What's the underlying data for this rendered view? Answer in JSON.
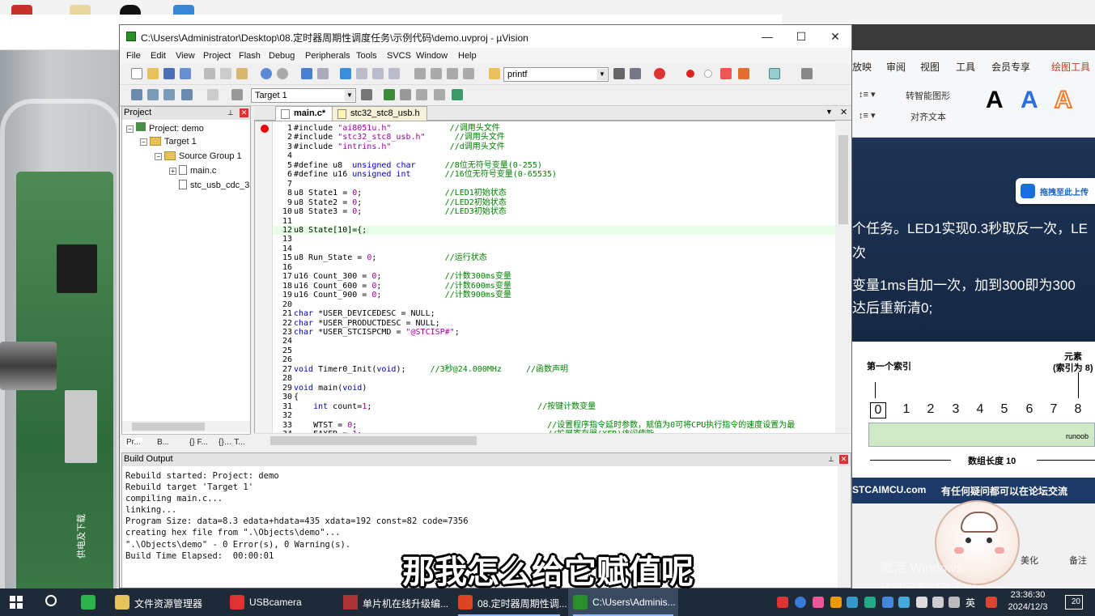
{
  "window": {
    "title": "C:\\Users\\Administrator\\Desktop\\08.定时器周期性调度任务\\示例代码\\demo.uvproj - µVision",
    "minimize": "—",
    "maximize": "☐",
    "close": "✕"
  },
  "menu": [
    "File",
    "Edit",
    "View",
    "Project",
    "Flash",
    "Debug",
    "Peripherals",
    "Tools",
    "SVCS",
    "Window",
    "Help"
  ],
  "toolbar": {
    "find_combo": "printf",
    "target_combo": "Target 1"
  },
  "project_panel": {
    "title": "Project",
    "root": "Project: demo",
    "target": "Target 1",
    "group": "Source Group 1",
    "files": [
      "main.c",
      "stc_usb_cdc_3"
    ],
    "tabs": [
      "Pr...",
      "B...",
      "{} F...",
      "{}… T..."
    ]
  },
  "editor": {
    "tabs": [
      "main.c*",
      "stc32_stc8_usb.h"
    ],
    "lines": [
      {
        "n": "1",
        "parts": [
          [
            "t",
            "#include "
          ],
          [
            "s",
            "\"ai8051u.h\""
          ],
          [
            "p",
            "            "
          ],
          [
            "c",
            "//调用头文件"
          ]
        ]
      },
      {
        "n": "2",
        "parts": [
          [
            "t",
            "#include "
          ],
          [
            "s",
            "\"stc32_stc8_usb.h\""
          ],
          [
            "p",
            "      "
          ],
          [
            "c",
            "//调用头文件"
          ]
        ]
      },
      {
        "n": "3",
        "parts": [
          [
            "t",
            "#include "
          ],
          [
            "s",
            "\"intrins.h\""
          ],
          [
            "p",
            "            "
          ],
          [
            "c",
            "//d调用头文件"
          ]
        ]
      },
      {
        "n": "4",
        "parts": []
      },
      {
        "n": "5",
        "parts": [
          [
            "t",
            "#define u8  "
          ],
          [
            "k",
            "unsigned char"
          ],
          [
            "p",
            "      "
          ],
          [
            "c",
            "//8位无符号变量(0-255)"
          ]
        ]
      },
      {
        "n": "6",
        "parts": [
          [
            "t",
            "#define u16 "
          ],
          [
            "k",
            "unsigned int"
          ],
          [
            "p",
            "       "
          ],
          [
            "c",
            "//16位无符号变量(0-65535)"
          ]
        ]
      },
      {
        "n": "7",
        "parts": []
      },
      {
        "n": "8",
        "parts": [
          [
            "t",
            "u8 State1 = "
          ],
          [
            "n",
            "0"
          ],
          [
            "t",
            ";"
          ],
          [
            "p",
            "                 "
          ],
          [
            "c",
            "//LED1初始状态"
          ]
        ]
      },
      {
        "n": "9",
        "parts": [
          [
            "t",
            "u8 State2 = "
          ],
          [
            "n",
            "0"
          ],
          [
            "t",
            ";"
          ],
          [
            "p",
            "                 "
          ],
          [
            "c",
            "//LED2初始状态"
          ]
        ]
      },
      {
        "n": "10",
        "parts": [
          [
            "t",
            "u8 State3 = "
          ],
          [
            "n",
            "0"
          ],
          [
            "t",
            ";"
          ],
          [
            "p",
            "                 "
          ],
          [
            "c",
            "//LED3初始状态"
          ]
        ]
      },
      {
        "n": "11",
        "parts": []
      },
      {
        "n": "12",
        "hl": true,
        "parts": [
          [
            "t",
            "u8 State[10]={;"
          ]
        ]
      },
      {
        "n": "13",
        "parts": []
      },
      {
        "n": "14",
        "parts": []
      },
      {
        "n": "15",
        "parts": [
          [
            "t",
            "u8 Run_State = "
          ],
          [
            "n",
            "0"
          ],
          [
            "t",
            ";"
          ],
          [
            "p",
            "              "
          ],
          [
            "c",
            "//运行状态"
          ]
        ]
      },
      {
        "n": "16",
        "parts": []
      },
      {
        "n": "17",
        "parts": [
          [
            "t",
            "u16 Count_300 = "
          ],
          [
            "n",
            "0"
          ],
          [
            "t",
            ";"
          ],
          [
            "p",
            "             "
          ],
          [
            "c",
            "//计数300ms变量"
          ]
        ]
      },
      {
        "n": "18",
        "parts": [
          [
            "t",
            "u16 Count_600 = "
          ],
          [
            "n",
            "0"
          ],
          [
            "t",
            ";"
          ],
          [
            "p",
            "             "
          ],
          [
            "c",
            "//计数600ms变量"
          ]
        ]
      },
      {
        "n": "19",
        "parts": [
          [
            "t",
            "u16 Count_900 = "
          ],
          [
            "n",
            "0"
          ],
          [
            "t",
            ";"
          ],
          [
            "p",
            "             "
          ],
          [
            "c",
            "//计数900ms变量"
          ]
        ]
      },
      {
        "n": "20",
        "parts": []
      },
      {
        "n": "21",
        "parts": [
          [
            "k",
            "char"
          ],
          [
            "t",
            " *USER_DEVICEDESC = NULL;"
          ]
        ]
      },
      {
        "n": "22",
        "parts": [
          [
            "k",
            "char"
          ],
          [
            "t",
            " *USER_PRODUCTDESC = NULL;"
          ]
        ]
      },
      {
        "n": "23",
        "parts": [
          [
            "k",
            "char"
          ],
          [
            "t",
            " *USER_STCISPCMD = "
          ],
          [
            "s",
            "\"@STCISP#\""
          ],
          [
            "t",
            ";"
          ]
        ]
      },
      {
        "n": "24",
        "parts": []
      },
      {
        "n": "25",
        "parts": []
      },
      {
        "n": "26",
        "parts": []
      },
      {
        "n": "27",
        "parts": [
          [
            "k",
            "void"
          ],
          [
            "t",
            " Timer0_Init("
          ],
          [
            "k",
            "void"
          ],
          [
            "t",
            ");"
          ],
          [
            "p",
            "     "
          ],
          [
            "c",
            "//3秒@24.000MHz"
          ],
          [
            "p",
            "     "
          ],
          [
            "c",
            "//函数声明"
          ]
        ]
      },
      {
        "n": "28",
        "parts": []
      },
      {
        "n": "29",
        "parts": [
          [
            "k",
            "void"
          ],
          [
            "t",
            " main("
          ],
          [
            "k",
            "void"
          ],
          [
            "t",
            ")"
          ]
        ]
      },
      {
        "n": "30",
        "parts": [
          [
            "t",
            "{"
          ]
        ]
      },
      {
        "n": "31",
        "parts": [
          [
            "p",
            "    "
          ],
          [
            "k",
            "int"
          ],
          [
            "t",
            " count="
          ],
          [
            "n",
            "1"
          ],
          [
            "t",
            ";"
          ],
          [
            "p",
            "                                  "
          ],
          [
            "c",
            "//按键计数变量"
          ]
        ]
      },
      {
        "n": "32",
        "parts": []
      },
      {
        "n": "33",
        "parts": [
          [
            "p",
            "    "
          ],
          [
            "t",
            "WTST = "
          ],
          [
            "n",
            "0"
          ],
          [
            "t",
            ";"
          ],
          [
            "p",
            "                                       "
          ],
          [
            "c",
            "//设置程序指令延时参数，赋值为0可将CPU执行指令的速度设置为最"
          ]
        ]
      },
      {
        "n": "34",
        "parts": [
          [
            "p",
            "    "
          ],
          [
            "t",
            "EAXFR = "
          ],
          [
            "n",
            "1"
          ],
          [
            "t",
            ";"
          ],
          [
            "p",
            "                                      "
          ],
          [
            "c",
            "//扩展寄存器(XFR)访问使能"
          ]
        ]
      }
    ]
  },
  "build_output": {
    "title": "Build Output",
    "lines": [
      "Rebuild started: Project: demo",
      "Rebuild target 'Target 1'",
      "compiling main.c...",
      "linking...",
      "Program Size: data=8.3 edata+hdata=435 xdata=192 const=82 code=7356",
      "creating hex file from \".\\Objects\\demo\"...",
      "\".\\Objects\\demo\" - 0 Error(s), 0 Warning(s).",
      "Build Time Elapsed:  00:00:01"
    ]
  },
  "right_doc": {
    "ribbon_tabs": [
      "放映",
      "审阅",
      "视图",
      "工具",
      "会员专享",
      "绘图工具"
    ],
    "ribbon_small": [
      "转智能图形",
      "对齐文本"
    ],
    "upload": "拖拽至此上传",
    "slide_text": [
      "个任务。LED1实现0.3秒取反一次，LE",
      "次",
      "变量1ms自加一次，加到300即为300",
      "达后重新清0;"
    ],
    "array_first_index": "第一个索引",
    "array_element": "元素",
    "array_element_index": "(索引为 8)",
    "indices": [
      "0",
      "1",
      "2",
      "3",
      "4",
      "5",
      "6",
      "7",
      "8"
    ],
    "array_cell_label": "runoob",
    "array_length": "数组长度 10",
    "footer_site": "STCAIMCU.com",
    "footer_text": "有任何疑问都可以在论坛交流",
    "lower_text": "美化",
    "lower_text2": "备注"
  },
  "subtitle": "那我怎么给它赋值呢",
  "watermark": "激活 Windows",
  "watermark_sub": "转到\"设置\"以激活 Windows。",
  "camera_label": "供电及下载",
  "taskbar": {
    "apps": [
      "文件资源管理器",
      "USBcamera",
      "单片机在线升级编...",
      "08.定时器周期性调...",
      "C:\\Users\\Adminis..."
    ],
    "time": "23:36:30",
    "date": "2024/12/3",
    "ime": "英",
    "notif": "20"
  },
  "colors": {
    "keyword": "#0000c8",
    "string": "#a000a0",
    "comment": "#008000",
    "taskbar": "#1f2a38",
    "slide": "#1e3455"
  }
}
